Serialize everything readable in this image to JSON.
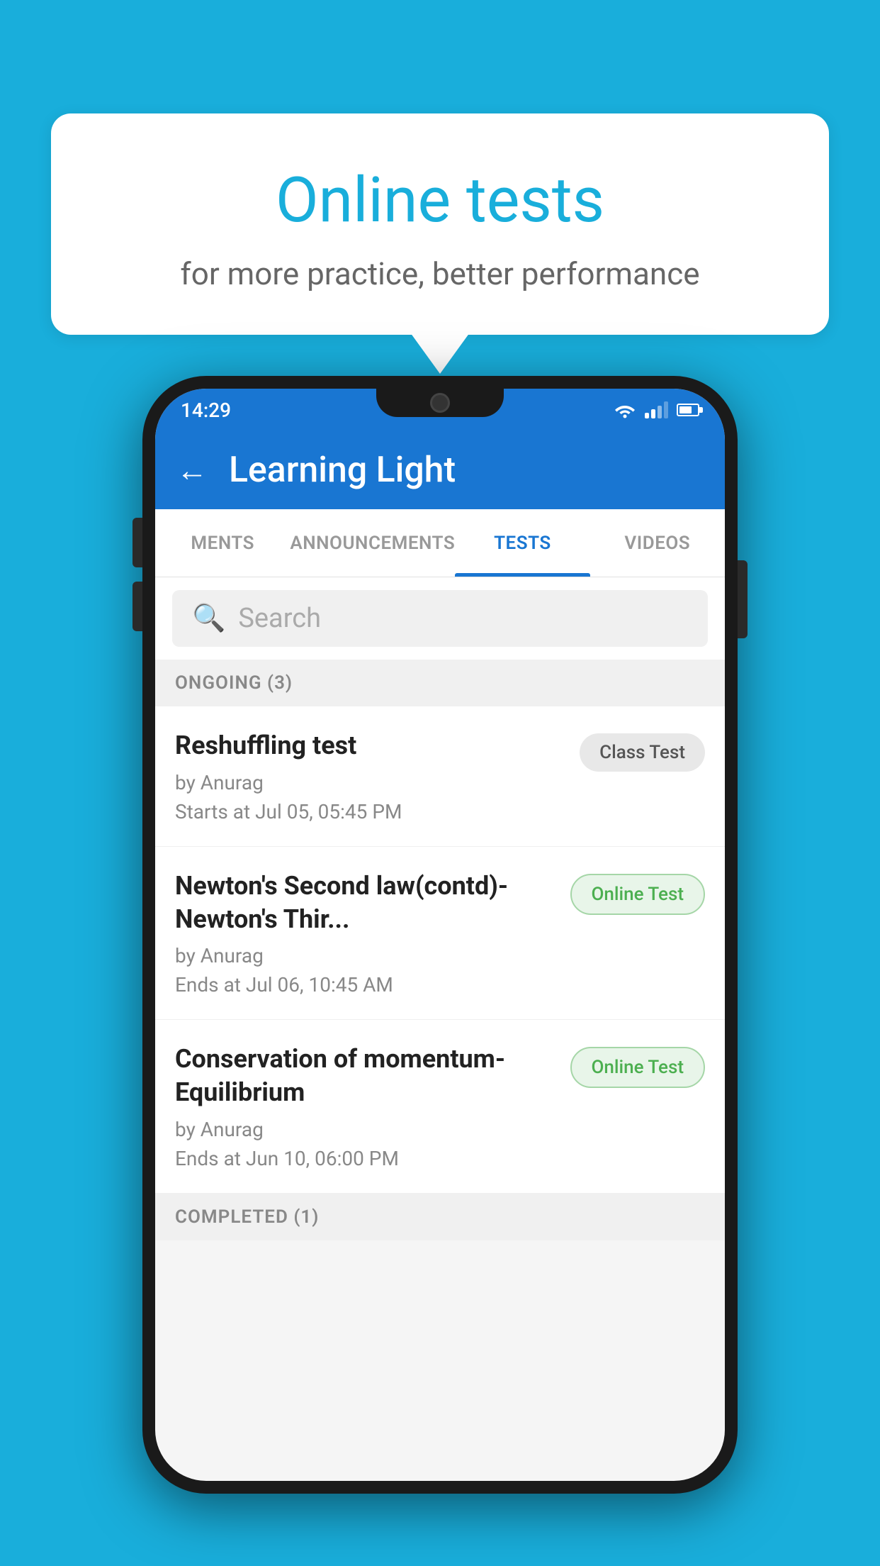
{
  "background_color": "#19AEDB",
  "speech_bubble": {
    "title": "Online tests",
    "subtitle": "for more practice, better performance"
  },
  "phone": {
    "status_bar": {
      "time": "14:29"
    },
    "app_bar": {
      "title": "Learning Light",
      "back_label": "←"
    },
    "tabs": [
      {
        "label": "MENTS",
        "active": false
      },
      {
        "label": "ANNOUNCEMENTS",
        "active": false
      },
      {
        "label": "TESTS",
        "active": true
      },
      {
        "label": "VIDEOS",
        "active": false
      }
    ],
    "search": {
      "placeholder": "Search"
    },
    "section_ongoing": {
      "label": "ONGOING (3)"
    },
    "tests": [
      {
        "name": "Reshuffling test",
        "author": "by Anurag",
        "time_label": "Starts at  Jul 05, 05:45 PM",
        "badge": "Class Test",
        "badge_type": "class"
      },
      {
        "name": "Newton's Second law(contd)-Newton's Thir...",
        "author": "by Anurag",
        "time_label": "Ends at  Jul 06, 10:45 AM",
        "badge": "Online Test",
        "badge_type": "online"
      },
      {
        "name": "Conservation of momentum-Equilibrium",
        "author": "by Anurag",
        "time_label": "Ends at  Jun 10, 06:00 PM",
        "badge": "Online Test",
        "badge_type": "online"
      }
    ],
    "section_completed": {
      "label": "COMPLETED (1)"
    }
  }
}
